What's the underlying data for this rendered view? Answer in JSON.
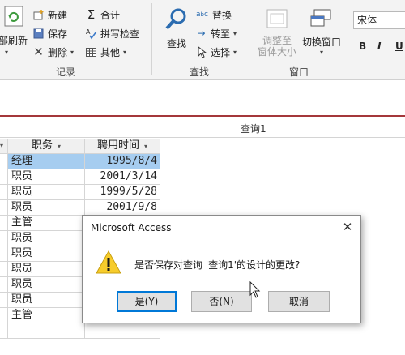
{
  "ribbon": {
    "groups": {
      "records": "记录",
      "find": "查找",
      "window": "窗口"
    },
    "records": {
      "refresh": "部刷新",
      "new": "新建",
      "save": "保存",
      "delete": "删除",
      "totals": "合计",
      "spelling": "拼写检查",
      "more": "其他"
    },
    "find": {
      "find": "查找",
      "replace": "替换",
      "goto": "转至",
      "select": "选择"
    },
    "window": {
      "fit_line1": "调整至",
      "fit_line2": "窗体大小",
      "switch": "切换窗口"
    },
    "text_format": {
      "font": "宋体",
      "bold": "B",
      "italic": "I",
      "underline": "U"
    }
  },
  "document_tab": {
    "title": "查询1"
  },
  "datasheet": {
    "columns": [
      "职务",
      "聘用时间"
    ],
    "rows": [
      {
        "position": "经理",
        "hire_date": "1995/8/4",
        "selected": true
      },
      {
        "position": "职员",
        "hire_date": "2001/3/14"
      },
      {
        "position": "职员",
        "hire_date": "1999/5/28"
      },
      {
        "position": "职员",
        "hire_date": "2001/9/8"
      },
      {
        "position": "主管",
        "hire_date": ""
      },
      {
        "position": "职员",
        "hire_date": ""
      },
      {
        "position": "职员",
        "hire_date": ""
      },
      {
        "position": "职员",
        "hire_date": ""
      },
      {
        "position": "职员",
        "hire_date": ""
      },
      {
        "position": "职员",
        "hire_date": ""
      },
      {
        "position": "主管",
        "hire_date": ""
      }
    ]
  },
  "dialog": {
    "title": "Microsoft Access",
    "message": "是否保存对查询 '查询1'的设计的更改?",
    "buttons": {
      "yes": "是(Y)",
      "no": "否(N)",
      "cancel": "取消"
    }
  },
  "colors": {
    "accent_blue": "#0078d7",
    "selection": "#a6cdf0",
    "tab_accent": "#a4373a",
    "warning_yellow": "#f7cc2b"
  }
}
